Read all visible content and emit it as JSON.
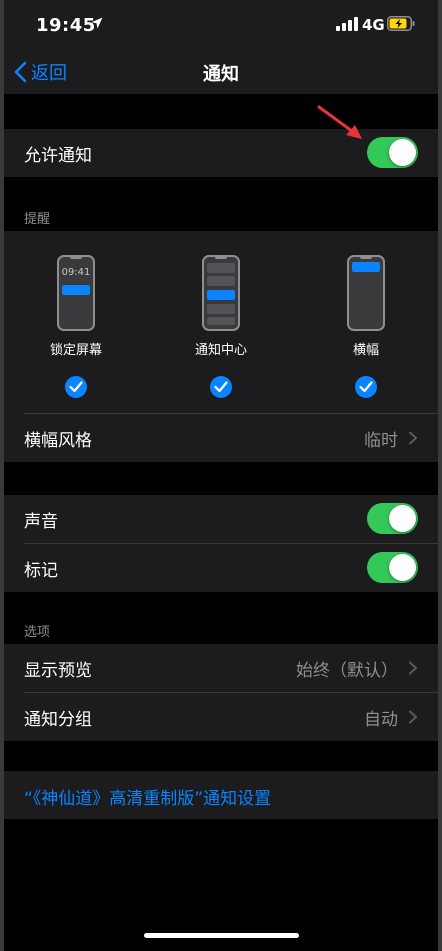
{
  "status_bar": {
    "time": "19:45",
    "network": "4G"
  },
  "nav": {
    "back_label": "返回",
    "title": "通知"
  },
  "allow": {
    "label": "允许通知",
    "enabled": true
  },
  "alerts": {
    "header": "提醒",
    "styles": [
      {
        "label": "锁定屏幕",
        "preview_time": "09:41",
        "checked": true
      },
      {
        "label": "通知中心",
        "checked": true
      },
      {
        "label": "横幅",
        "checked": true
      }
    ],
    "banner_style": {
      "label": "横幅风格",
      "value": "临时"
    }
  },
  "sound": {
    "label": "声音",
    "enabled": true
  },
  "badge": {
    "label": "标记",
    "enabled": true
  },
  "options": {
    "header": "选项",
    "show_previews": {
      "label": "显示预览",
      "value": "始终（默认）"
    },
    "grouping": {
      "label": "通知分组",
      "value": "自动"
    }
  },
  "app_settings_link": "“《神仙道》高清重制版”通知设置",
  "colors": {
    "accent": "#0a84ff",
    "toggle_on": "#34c759",
    "annotation_arrow": "#e8353b"
  }
}
